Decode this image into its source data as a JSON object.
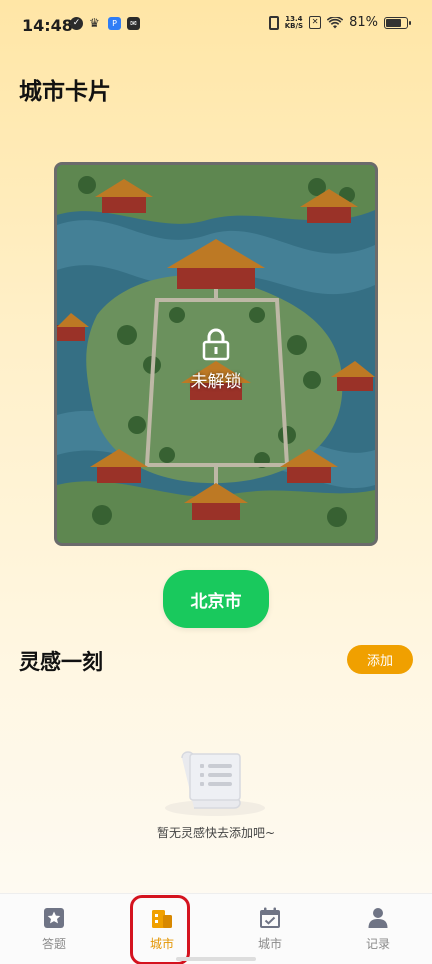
{
  "status_bar": {
    "time": "14:48",
    "net_speed_value": "13.4",
    "net_speed_unit": "KB/S",
    "battery": "81%",
    "battery_level": 0.81,
    "icons": [
      "check-circle-icon",
      "crown-icon",
      "app-blue-icon",
      "mail-icon",
      "vibrate-icon",
      "xbox-icon",
      "wifi-icon",
      "battery-icon"
    ]
  },
  "header": {
    "title": "城市卡片"
  },
  "city_card": {
    "lock_label": "未解锁",
    "lock_icon": "lock-icon"
  },
  "city_button": {
    "label": "北京市",
    "color": "#19c95d"
  },
  "inspiration": {
    "title": "灵感一刻",
    "add_label": "添加",
    "add_color": "#f0a000",
    "empty_text": "暂无灵感快去添加吧~"
  },
  "tabs": [
    {
      "label": "答题",
      "icon": "star-icon",
      "active": false
    },
    {
      "label": "城市",
      "icon": "city-building-icon",
      "active": true
    },
    {
      "label": "城市",
      "icon": "calendar-check-icon",
      "active": false
    },
    {
      "label": "记录",
      "icon": "person-icon",
      "active": false
    }
  ],
  "accent_color": "#e39500"
}
